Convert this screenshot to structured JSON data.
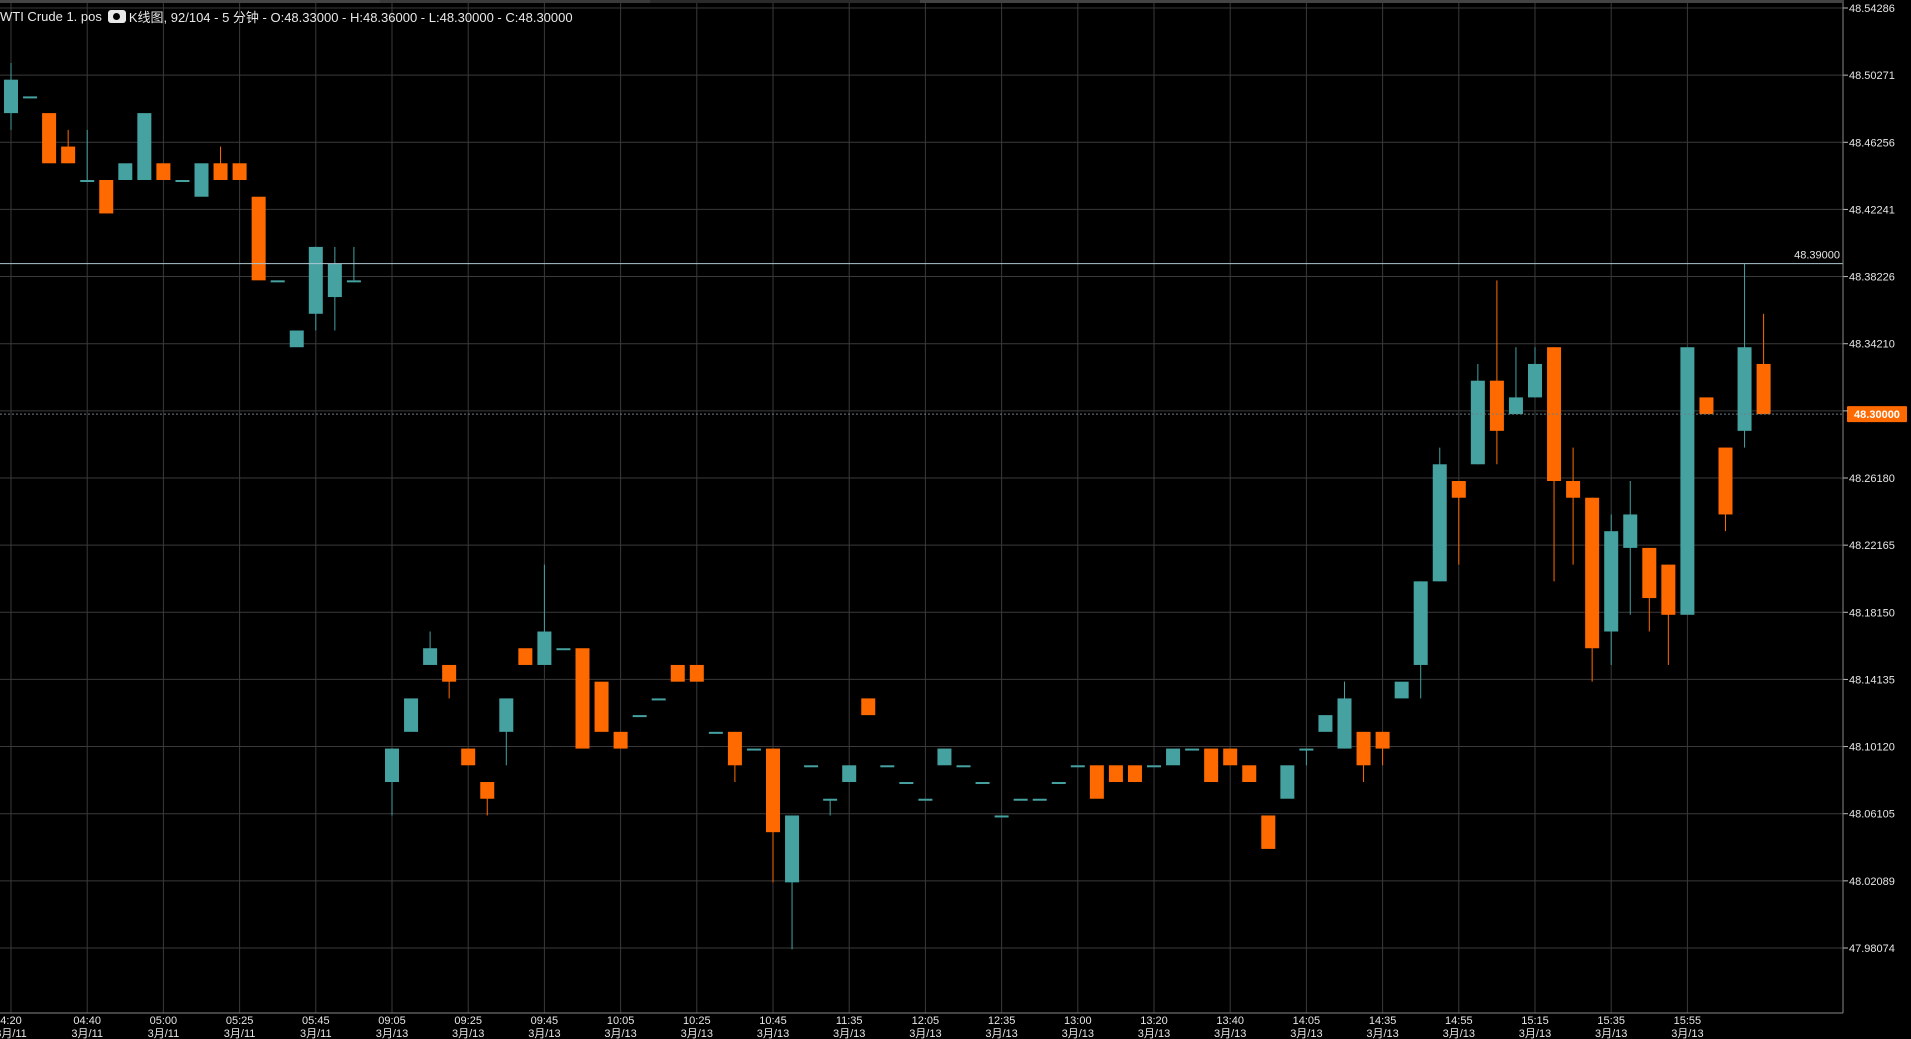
{
  "header": {
    "symbol": "WTI Crude 1. pos",
    "info": "K线图, 92/104 - 5 分钟 - O:48.33000 - H:48.36000 - L:48.30000 - C:48.30000"
  },
  "colors": {
    "up": "#46a1a1",
    "down": "#ff6a00",
    "grid": "#3a3a3a",
    "text": "#e6e6e6",
    "price_line": "#aec8d2",
    "price_badge": "#ff6a00"
  },
  "chart_data": {
    "type": "candlestick",
    "ylim": [
      47.95,
      48.5425
    ],
    "y_ticks": [
      48.54286,
      48.50271,
      48.46256,
      48.42241,
      48.38226,
      48.3421,
      48.30195,
      48.2618,
      48.22165,
      48.1815,
      48.14135,
      48.1012,
      48.06105,
      48.02089,
      47.98074
    ],
    "y_tick_labels": [
      "48.54286",
      "48.50271",
      "48.46256",
      "48.42241",
      "48.38226",
      "48.34210",
      "",
      "48.26180",
      "48.22165",
      "48.18150",
      "48.14135",
      "48.10120",
      "48.06105",
      "48.02089",
      "47.98074"
    ],
    "x_ticks": [
      {
        "index": 0,
        "time": "4:20",
        "date": "3月/11"
      },
      {
        "index": 4,
        "time": "04:40",
        "date": "3月/11"
      },
      {
        "index": 8,
        "time": "05:00",
        "date": "3月/11"
      },
      {
        "index": 12,
        "time": "05:25",
        "date": "3月/11"
      },
      {
        "index": 16,
        "time": "05:45",
        "date": "3月/11"
      },
      {
        "index": 20,
        "time": "09:05",
        "date": "3月/13"
      },
      {
        "index": 24,
        "time": "09:25",
        "date": "3月/13"
      },
      {
        "index": 28,
        "time": "09:45",
        "date": "3月/13"
      },
      {
        "index": 32,
        "time": "10:05",
        "date": "3月/13"
      },
      {
        "index": 36,
        "time": "10:25",
        "date": "3月/13"
      },
      {
        "index": 40,
        "time": "10:45",
        "date": "3月/13"
      },
      {
        "index": 44,
        "time": "11:35",
        "date": "3月/13"
      },
      {
        "index": 48,
        "time": "12:05",
        "date": "3月/13"
      },
      {
        "index": 52,
        "time": "12:35",
        "date": "3月/13"
      },
      {
        "index": 56,
        "time": "13:00",
        "date": "3月/13"
      },
      {
        "index": 60,
        "time": "13:20",
        "date": "3月/13"
      },
      {
        "index": 64,
        "time": "13:40",
        "date": "3月/13"
      },
      {
        "index": 68,
        "time": "14:05",
        "date": "3月/13"
      },
      {
        "index": 72,
        "time": "14:35",
        "date": "3月/13"
      },
      {
        "index": 76,
        "time": "14:55",
        "date": "3月/13"
      },
      {
        "index": 80,
        "time": "15:15",
        "date": "3月/13"
      },
      {
        "index": 84,
        "time": "15:35",
        "date": "3月/13"
      },
      {
        "index": 88,
        "time": "15:55",
        "date": "3月/13"
      }
    ],
    "first_candle_index": 0,
    "candles": [
      [
        48.48,
        48.51,
        48.47,
        48.5
      ],
      [
        48.49,
        48.49,
        48.49,
        48.49
      ],
      [
        48.48,
        48.48,
        48.45,
        48.45
      ],
      [
        48.46,
        48.47,
        48.45,
        48.45
      ],
      [
        48.44,
        48.47,
        48.44,
        48.44
      ],
      [
        48.44,
        48.44,
        48.42,
        48.42
      ],
      [
        48.44,
        48.45,
        48.44,
        48.45
      ],
      [
        48.44,
        48.48,
        48.44,
        48.48
      ],
      [
        48.45,
        48.45,
        48.44,
        48.44
      ],
      [
        48.44,
        48.44,
        48.44,
        48.44
      ],
      [
        48.43,
        48.45,
        48.43,
        48.45
      ],
      [
        48.45,
        48.46,
        48.44,
        48.44
      ],
      [
        48.45,
        48.45,
        48.44,
        48.44
      ],
      [
        48.43,
        48.43,
        48.38,
        48.38
      ],
      [
        48.38,
        48.38,
        48.38,
        48.38
      ],
      [
        48.34,
        48.35,
        48.34,
        48.35
      ],
      [
        48.36,
        48.4,
        48.35,
        48.4
      ],
      [
        48.37,
        48.4,
        48.35,
        48.39
      ],
      [
        48.38,
        48.4,
        48.38,
        48.38
      ],
      null,
      [
        48.08,
        48.1,
        48.06,
        48.1
      ],
      [
        48.11,
        48.13,
        48.11,
        48.13
      ],
      [
        48.15,
        48.17,
        48.15,
        48.16
      ],
      [
        48.15,
        48.15,
        48.13,
        48.14
      ],
      [
        48.1,
        48.1,
        48.09,
        48.09
      ],
      [
        48.08,
        48.08,
        48.06,
        48.07
      ],
      [
        48.11,
        48.13,
        48.09,
        48.13
      ],
      [
        48.16,
        48.16,
        48.15,
        48.15
      ],
      [
        48.15,
        48.21,
        48.15,
        48.17
      ],
      [
        48.16,
        48.16,
        48.16,
        48.16
      ],
      [
        48.16,
        48.16,
        48.1,
        48.1
      ],
      [
        48.14,
        48.14,
        48.11,
        48.11
      ],
      [
        48.11,
        48.11,
        48.1,
        48.1
      ],
      [
        48.12,
        48.12,
        48.12,
        48.12
      ],
      [
        48.13,
        48.13,
        48.13,
        48.13
      ],
      [
        48.15,
        48.15,
        48.14,
        48.14
      ],
      [
        48.15,
        48.15,
        48.14,
        48.14
      ],
      [
        48.11,
        48.11,
        48.11,
        48.11
      ],
      [
        48.11,
        48.11,
        48.08,
        48.09
      ],
      [
        48.1,
        48.1,
        48.1,
        48.1
      ],
      [
        48.1,
        48.1,
        48.02,
        48.05
      ],
      [
        48.02,
        48.06,
        47.98,
        48.06
      ],
      [
        48.09,
        48.09,
        48.09,
        48.09
      ],
      [
        48.07,
        48.07,
        48.06,
        48.07
      ],
      [
        48.08,
        48.09,
        48.08,
        48.09
      ],
      [
        48.13,
        48.13,
        48.12,
        48.12
      ],
      [
        48.09,
        48.09,
        48.09,
        48.09
      ],
      [
        48.08,
        48.08,
        48.08,
        48.08
      ],
      [
        48.07,
        48.07,
        48.07,
        48.07
      ],
      [
        48.09,
        48.1,
        48.09,
        48.1
      ],
      [
        48.09,
        48.09,
        48.09,
        48.09
      ],
      [
        48.08,
        48.08,
        48.08,
        48.08
      ],
      [
        48.06,
        48.06,
        48.06,
        48.06
      ],
      [
        48.07,
        48.07,
        48.07,
        48.07
      ],
      [
        48.07,
        48.07,
        48.07,
        48.07
      ],
      [
        48.08,
        48.08,
        48.08,
        48.08
      ],
      [
        48.09,
        48.09,
        48.09,
        48.09
      ],
      [
        48.09,
        48.09,
        48.07,
        48.07
      ],
      [
        48.09,
        48.09,
        48.08,
        48.08
      ],
      [
        48.09,
        48.09,
        48.08,
        48.08
      ],
      [
        48.09,
        48.09,
        48.09,
        48.09
      ],
      [
        48.09,
        48.1,
        48.09,
        48.1
      ],
      [
        48.1,
        48.1,
        48.1,
        48.1
      ],
      [
        48.1,
        48.1,
        48.08,
        48.08
      ],
      [
        48.1,
        48.1,
        48.09,
        48.09
      ],
      [
        48.09,
        48.09,
        48.08,
        48.08
      ],
      [
        48.06,
        48.06,
        48.04,
        48.04
      ],
      [
        48.07,
        48.09,
        48.07,
        48.09
      ],
      [
        48.1,
        48.1,
        48.09,
        48.1
      ],
      [
        48.11,
        48.12,
        48.11,
        48.12
      ],
      [
        48.1,
        48.14,
        48.1,
        48.13
      ],
      [
        48.11,
        48.11,
        48.08,
        48.09
      ],
      [
        48.11,
        48.11,
        48.09,
        48.1
      ],
      [
        48.13,
        48.14,
        48.13,
        48.14
      ],
      [
        48.15,
        48.2,
        48.13,
        48.2
      ],
      [
        48.2,
        48.28,
        48.2,
        48.27
      ],
      [
        48.26,
        48.26,
        48.21,
        48.25
      ],
      [
        48.27,
        48.33,
        48.27,
        48.32
      ],
      [
        48.32,
        48.38,
        48.27,
        48.29
      ],
      [
        48.3,
        48.34,
        48.3,
        48.31
      ],
      [
        48.31,
        48.34,
        48.31,
        48.33
      ],
      [
        48.34,
        48.34,
        48.2,
        48.26
      ],
      [
        48.26,
        48.28,
        48.21,
        48.25
      ],
      [
        48.25,
        48.25,
        48.14,
        48.16
      ],
      [
        48.17,
        48.24,
        48.15,
        48.23
      ],
      [
        48.22,
        48.26,
        48.18,
        48.24
      ],
      [
        48.22,
        48.22,
        48.17,
        48.19
      ],
      [
        48.21,
        48.21,
        48.15,
        48.18
      ],
      [
        48.18,
        48.34,
        48.18,
        48.34
      ],
      [
        48.31,
        48.31,
        48.3,
        48.3
      ],
      [
        48.28,
        48.28,
        48.23,
        48.24
      ],
      [
        48.29,
        48.39,
        48.28,
        48.34
      ],
      [
        48.33,
        48.36,
        48.3,
        48.3
      ]
    ],
    "reference_line": {
      "value": 48.39,
      "label": "48.39000"
    },
    "current_price": {
      "value": 48.3,
      "label": "48.30000"
    }
  }
}
